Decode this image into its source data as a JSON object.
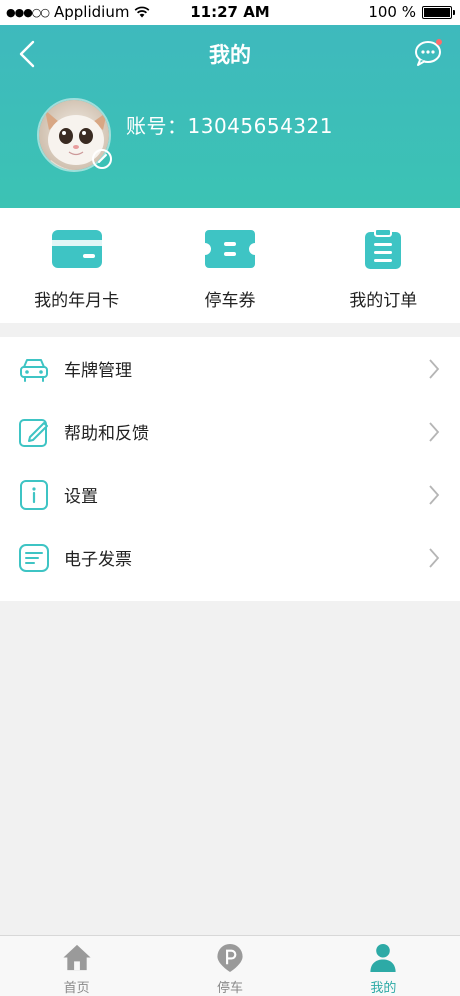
{
  "status_bar": {
    "carrier": "Applidium",
    "time": "11:27 AM",
    "battery": "100 %"
  },
  "header": {
    "title": "我的",
    "account": "账号：13045654321"
  },
  "quick_actions": [
    {
      "label": "我的年月卡",
      "icon": "card-icon"
    },
    {
      "label": "停车券",
      "icon": "ticket-icon"
    },
    {
      "label": "我的订单",
      "icon": "clipboard-icon"
    }
  ],
  "menu": [
    {
      "label": "车牌管理",
      "icon": "car-icon"
    },
    {
      "label": "帮助和反馈",
      "icon": "edit-icon"
    },
    {
      "label": "设置",
      "icon": "info-icon"
    },
    {
      "label": "电子发票",
      "icon": "invoice-icon"
    }
  ],
  "tabbar": [
    {
      "label": "首页",
      "icon": "home-icon",
      "active": false
    },
    {
      "label": "停车",
      "icon": "parking-icon",
      "active": false
    },
    {
      "label": "我的",
      "icon": "person-icon",
      "active": true
    }
  ],
  "colors": {
    "accent": "#3dbdba",
    "active_tab": "#2daaa6",
    "inactive_tab": "#8a8a8a"
  }
}
